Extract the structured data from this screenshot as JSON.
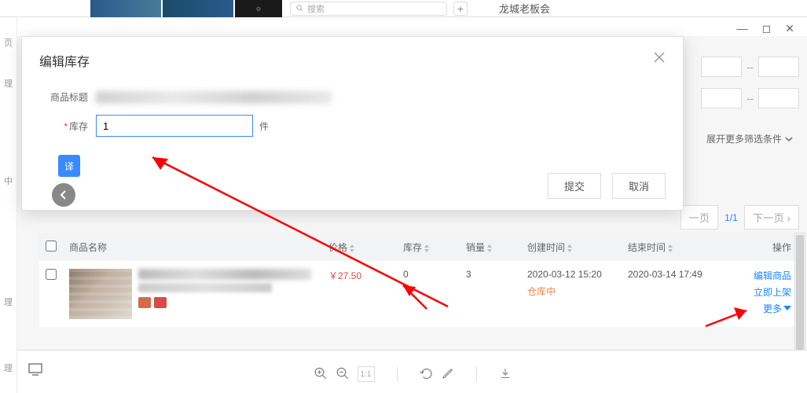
{
  "top": {
    "search_placeholder": "搜索",
    "title": "龙城老板会",
    "add": "+"
  },
  "sidebar": {
    "items": [
      "页",
      "理",
      "中",
      "理",
      "理"
    ]
  },
  "modal": {
    "title": "编辑库存",
    "label_product": "商品标题",
    "label_stock": "库存",
    "stock_value": "1",
    "unit": "件",
    "translate": "译",
    "submit": "提交",
    "cancel": "取消"
  },
  "filters": {
    "expand": "展开更多筛选条件",
    "sep": "--"
  },
  "pager": {
    "prev": "一页",
    "indicator": "1/1",
    "next": "下一页"
  },
  "table": {
    "headers": {
      "name": "商品名称",
      "price": "价格",
      "stock": "库存",
      "sales": "销量",
      "create": "创建时间",
      "end": "结束时间",
      "ops": "操作"
    },
    "row": {
      "price": "￥27.50",
      "stock": "0",
      "sales": "3",
      "ctime": "2020-03-12 15:20",
      "status": "仓库中",
      "etime": "2020-03-14 17:49",
      "ops": {
        "edit": "编辑商品",
        "shelf": "立即上架",
        "more": "更多"
      }
    }
  },
  "bottom": {
    "zoom_num": "1:1"
  }
}
